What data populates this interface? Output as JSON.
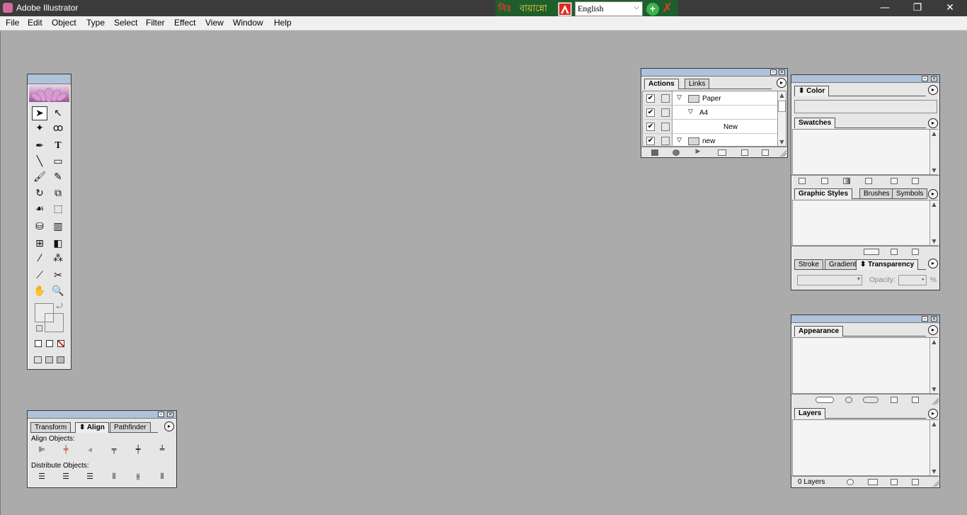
{
  "window": {
    "title": "Adobe Illustrator",
    "minimize": "—",
    "maximize": "❐",
    "close": "✕"
  },
  "keyboard_tool": {
    "logo": "নিঃ",
    "name": "বায়ান্নো",
    "language": "English",
    "caret": "⌵",
    "ok": "+",
    "close": "✗"
  },
  "menu": [
    "File",
    "Edit",
    "Object",
    "Type",
    "Select",
    "Filter",
    "Effect",
    "View",
    "Window",
    "Help"
  ],
  "align_palette": {
    "tabs": [
      "Transform",
      "Align",
      "Pathfinder"
    ],
    "align_objects_label": "Align Objects:",
    "distribute_objects_label": "Distribute Objects:"
  },
  "actions_palette": {
    "tabs": [
      "Actions",
      "Links"
    ],
    "rows": [
      {
        "checked": "✔",
        "expander": "▽",
        "label": "Paper"
      },
      {
        "checked": "✔",
        "expander": "▽",
        "label": "A4"
      },
      {
        "checked": "✔",
        "expander": "",
        "label": "New"
      },
      {
        "checked": "✔",
        "expander": "▽",
        "label": "new"
      }
    ]
  },
  "color_palette": {
    "tab": "Color"
  },
  "swatches_palette": {
    "tab": "Swatches"
  },
  "styles_palette": {
    "tabs": [
      "Graphic Styles",
      "Brushes",
      "Symbols"
    ]
  },
  "transparency_palette": {
    "tabs": [
      "Stroke",
      "Gradient",
      "Transparency"
    ],
    "opacity_label": "Opacity:",
    "opacity_unit": "%"
  },
  "appearance_palette": {
    "tab": "Appearance"
  },
  "layers_palette": {
    "tab": "Layers",
    "status": "0 Layers"
  },
  "icons": {
    "palette_menu": "▸",
    "tab_arrows": "⬍",
    "scroll_up": "▲",
    "scroll_down": "▼"
  },
  "colors": {
    "workspace": "#ababab",
    "palette_header": "#aec2dc",
    "titlebar": "#3b3b3b"
  }
}
